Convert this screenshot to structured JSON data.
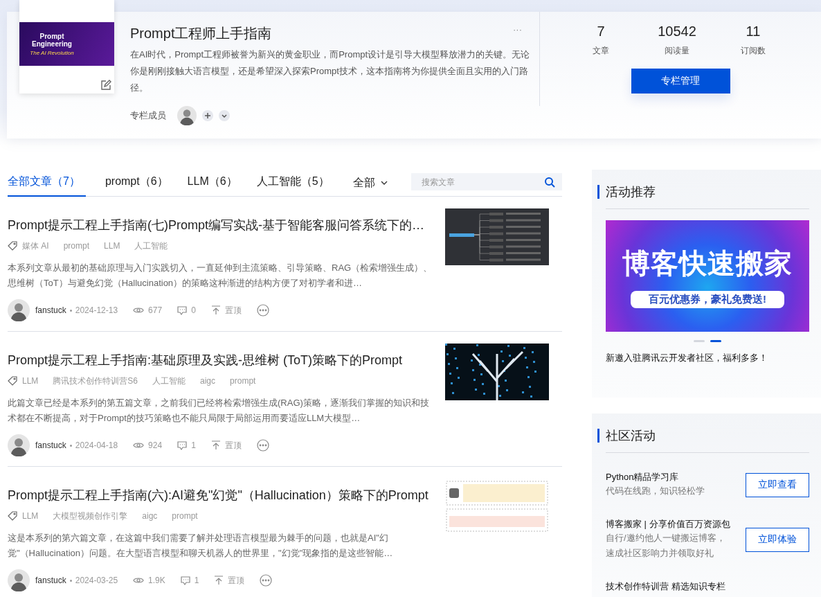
{
  "column": {
    "cover": {
      "title": "Prompt Engineering",
      "subtitle": "The AI Revolution"
    },
    "title": "Prompt工程师上手指南",
    "more": "···",
    "description": "在AI时代，Prompt工程师被誉为新兴的黄金职业，而Prompt设计是引导大模型释放潜力的关键。无论你是刚刚接触大语言模型，还是希望深入探索Prompt技术，这本指南将为你提供全面且实用的入门路径。",
    "members_label": "专栏成员",
    "stats": [
      {
        "value": "7",
        "label": "文章"
      },
      {
        "value": "10542",
        "label": "阅读量"
      },
      {
        "value": "11",
        "label": "订阅数"
      }
    ],
    "manage_button": "专栏管理"
  },
  "tabs": [
    {
      "label": "全部文章（7）",
      "selected": true
    },
    {
      "label": "prompt（6）",
      "selected": false
    },
    {
      "label": "LLM（6）",
      "selected": false
    },
    {
      "label": "人工智能（5）",
      "selected": false
    }
  ],
  "filter": {
    "label": "全部"
  },
  "search": {
    "placeholder": "搜索文章"
  },
  "articles": [
    {
      "title": "Prompt提示工程上手指南(七)Prompt编写实战-基于智能客服问答系统下的…",
      "tags": [
        "媒体 AI",
        "prompt",
        "LLM",
        "人工智能"
      ],
      "summary": "本系列文章从最初的基础原理与入门实践切入，一直延伸到主流策略、引导策略、RAG（检索增强生成）、思维树（ToT）与避免幻觉（Hallucination）的策略这种渐进的结构方便了对初学者和进…",
      "author": "fanstuck",
      "date": "2024-12-13",
      "views": "677",
      "comments": "0",
      "pin": "置顶"
    },
    {
      "title": "Prompt提示工程上手指南:基础原理及实践-思维树 (ToT)策略下的Prompt",
      "tags": [
        "LLM",
        "腾讯技术创作特训营S6",
        "人工智能",
        "aigc",
        "prompt"
      ],
      "summary": "此篇文章已经是本系列的第五篇文章，之前我们已经将检索增强生成(RAG)策略，逐渐我们掌握的知识和技术都在不断提高，对于Prompt的技巧策略也不能只局限于局部运用而要适应LLM大模型…",
      "author": "fanstuck",
      "date": "2024-04-18",
      "views": "924",
      "comments": "1",
      "pin": "置顶"
    },
    {
      "title": "Prompt提示工程上手指南(六):AI避免\"幻觉\"（Hallucination）策略下的Prompt",
      "tags": [
        "LLM",
        "大模型视频创作引擎",
        "aigc",
        "prompt"
      ],
      "summary": "这是本系列的第六篇文章，在这篇中我们需要了解并处理语言模型最为棘手的问题，也就是AI\"幻觉\"（Hallucination）问题。在大型语言模型和聊天机器人的世界里，\"幻觉\"现象指的是这些智能…",
      "author": "fanstuck",
      "date": "2024-03-25",
      "views": "1.9K",
      "comments": "1",
      "pin": "置顶"
    }
  ],
  "sidebar": {
    "promo": {
      "heading": "活动推荐",
      "banner": {
        "headline": "博客快速搬家",
        "subline": "百元优惠券，豪礼免费送!"
      },
      "slides": [
        {
          "selected": false
        },
        {
          "selected": true
        }
      ],
      "caption": "新邀入驻腾讯云开发者社区，福利多多！"
    },
    "community": {
      "heading": "社区活动",
      "items": [
        {
          "title": "Python精品学习库",
          "lines": [
            "代码在线跑，知识轻松学"
          ],
          "button": "立即查看"
        },
        {
          "title": "博客搬家 | 分享价值百万资源包",
          "lines": [
            "自行/邀约他人一键搬运博客，",
            "速成社区影响力并领取好礼"
          ],
          "button": "立即体验"
        },
        {
          "title": "技术创作特训营 精选知识专栏"
        }
      ]
    }
  }
}
